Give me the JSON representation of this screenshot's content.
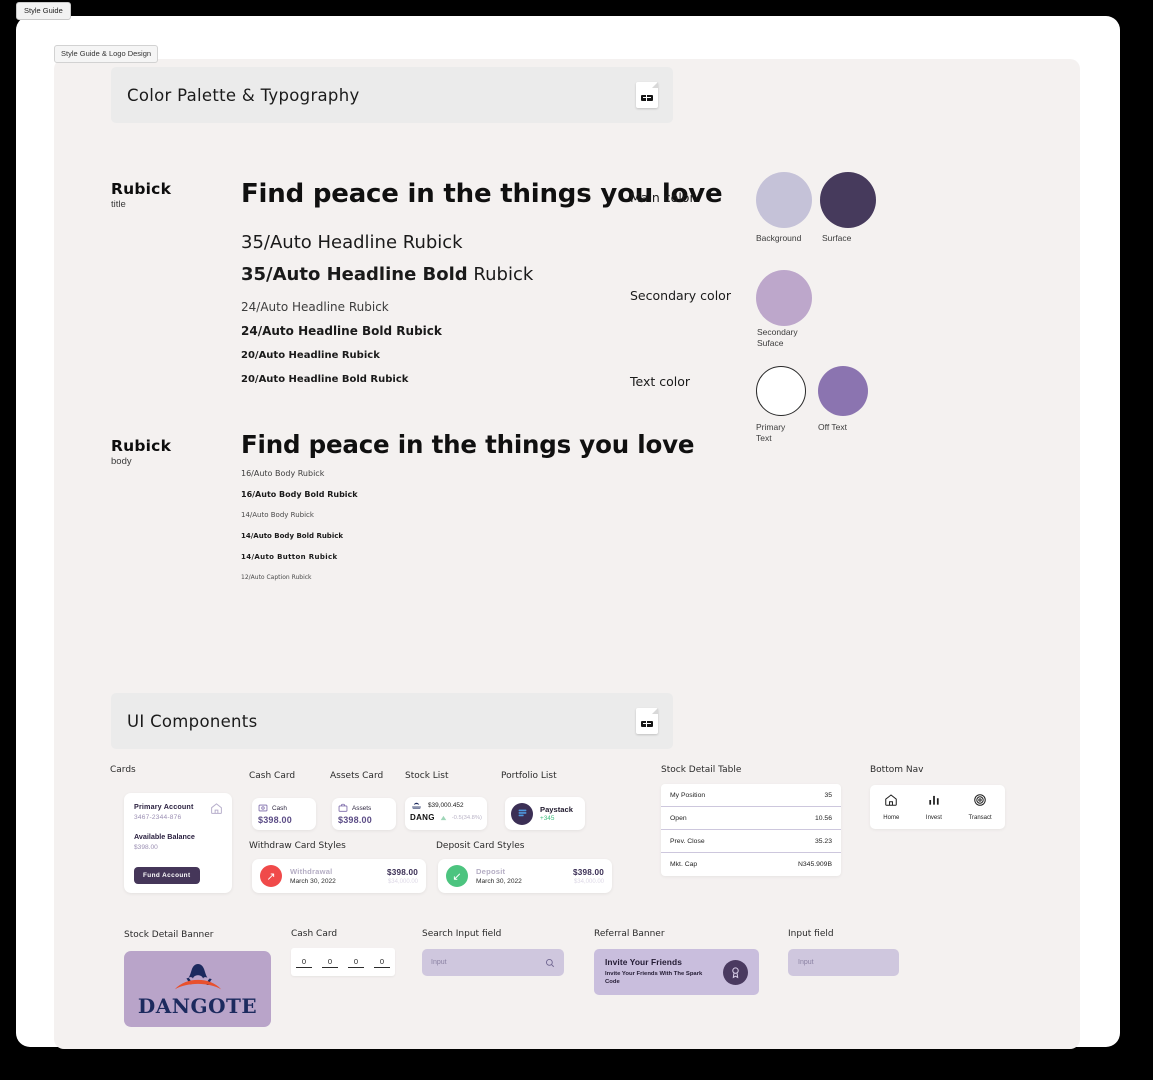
{
  "window": {
    "tab_label": "Style Guide"
  },
  "frame": {
    "label": "Style Guide & Logo Design"
  },
  "sections": {
    "palette_typography": {
      "title": "Color Palette & Typography",
      "icon": "document-face-icon"
    },
    "ui_components": {
      "title": "UI Components",
      "icon": "document-face-icon"
    }
  },
  "typography": {
    "title_group": {
      "family": "Rubick",
      "role": "title",
      "display_sample": "Find peace in the things you love",
      "specs": [
        {
          "text": "35/Auto Headline Rubick",
          "size": 18,
          "bold": false
        },
        {
          "bold_part": "35/Auto Headline Bold",
          "regular_part": " Rubick",
          "size": 18
        },
        {
          "text": "24/Auto Headline Rubick",
          "size": 12,
          "bold": false
        },
        {
          "text": "24/Auto Headline Bold Rubick",
          "size": 12,
          "bold": true
        },
        {
          "text": "20/Auto Headline Rubick",
          "size": 10,
          "bold": false
        },
        {
          "text": "20/Auto Headline Bold Rubick",
          "size": 10,
          "bold": true
        }
      ]
    },
    "body_group": {
      "family": "Rubick",
      "role": "body",
      "display_sample": "Find peace in the things you love",
      "specs": [
        {
          "text": "16/Auto Body Rubick",
          "size": 8,
          "bold": false
        },
        {
          "text": "16/Auto Body Bold Rubick",
          "size": 8,
          "bold": true
        },
        {
          "text": "14/Auto Body Rubick",
          "size": 7,
          "bold": false
        },
        {
          "text": "14/Auto Body Bold Rubick",
          "size": 7,
          "bold": true
        },
        {
          "text": "14/Auto Button Rubick",
          "size": 7,
          "bold": true
        },
        {
          "text": "12/Auto Caption Rubick",
          "size": 6,
          "bold": false
        }
      ]
    }
  },
  "palette": {
    "groups": [
      {
        "label": "Main color",
        "swatches": [
          {
            "caption": "Background",
            "hex": "#c5c2d8"
          },
          {
            "caption": "Surface",
            "hex": "#463a5c"
          }
        ]
      },
      {
        "label": "Secondary color",
        "swatches": [
          {
            "caption": "Secondary\nSuface",
            "hex": "#bda7cb"
          }
        ]
      },
      {
        "label": "Text color",
        "swatches": [
          {
            "caption": "Primary\nText",
            "hex": "#ffffff"
          },
          {
            "caption": "Off Text",
            "hex": "#8b74b0"
          }
        ]
      }
    ]
  },
  "components": {
    "labels": {
      "cards": "Cards",
      "cash_card": "Cash Card",
      "assets_card": "Assets Card",
      "stock_list": "Stock List",
      "portfolio_list": "Portfolio List",
      "withdraw_card_styles": "Withdraw Card Styles",
      "deposit_card_styles": "Deposit Card Styles",
      "stock_detail_table": "Stock Detail Table",
      "bottom_nav": "Bottom Nav",
      "stock_detail_banner": "Stock Detail Banner",
      "cash_card_2": "Cash Card",
      "search_input_field": "Search Input field",
      "referral_banner": "Referral Banner",
      "input_field": "Input field"
    },
    "primary_account": {
      "title": "Primary Account",
      "number": "3467-2344-876",
      "balance_label": "Available Balance",
      "balance": "$398.00",
      "button": "Fund Account",
      "icon": "home-icon"
    },
    "cash_card": {
      "label": "Cash",
      "amount": "$398.00",
      "icon": "cash-icon"
    },
    "assets_card": {
      "label": "Assets",
      "amount": "$398.00",
      "icon": "briefcase-icon"
    },
    "stock_list": {
      "ticker": "DANG",
      "price": "$39,000.452",
      "change": "-0.5(34.8%)",
      "icon": "dangote-mini-icon"
    },
    "portfolio_list": {
      "name": "Paystack",
      "change": "+345",
      "icon": "paystack-icon"
    },
    "withdrawal": {
      "label": "Withdrawal",
      "date": "March 30, 2022",
      "amount": "$398.00",
      "sub_amount": "$34,000.00",
      "accent": "#f04a4a",
      "icon": "arrow-up-right-icon"
    },
    "deposit": {
      "label": "Deposit",
      "date": "March 30, 2022",
      "amount": "$398.00",
      "sub_amount": "$34,000.00",
      "accent": "#4cc47f",
      "icon": "arrow-down-left-icon"
    },
    "stock_detail_table": {
      "rows": [
        {
          "key": "My Position",
          "value": "35"
        },
        {
          "key": "Open",
          "value": "10.56"
        },
        {
          "key": "Prev. Close",
          "value": "35.23"
        },
        {
          "key": "Mkt. Cap",
          "value": "N345.909B"
        }
      ]
    },
    "bottom_nav": {
      "items": [
        {
          "label": "Home",
          "icon": "home-icon"
        },
        {
          "label": "Invest",
          "icon": "bar-chart-icon"
        },
        {
          "label": "Transact",
          "icon": "target-icon"
        }
      ]
    },
    "stock_detail_banner": {
      "brand": "DANGOTE",
      "bg": "#b9a4c9",
      "icon": "dangote-eagle-icon"
    },
    "pin_card": {
      "digits": [
        "0",
        "0",
        "0",
        "0"
      ]
    },
    "search_input": {
      "placeholder": "Input",
      "icon": "search-icon"
    },
    "referral_banner": {
      "heading": "Invite Your Friends",
      "sub": "Invite Your Friends With The Spark Code",
      "icon": "medal-icon"
    },
    "input_field": {
      "placeholder": "Input"
    }
  }
}
